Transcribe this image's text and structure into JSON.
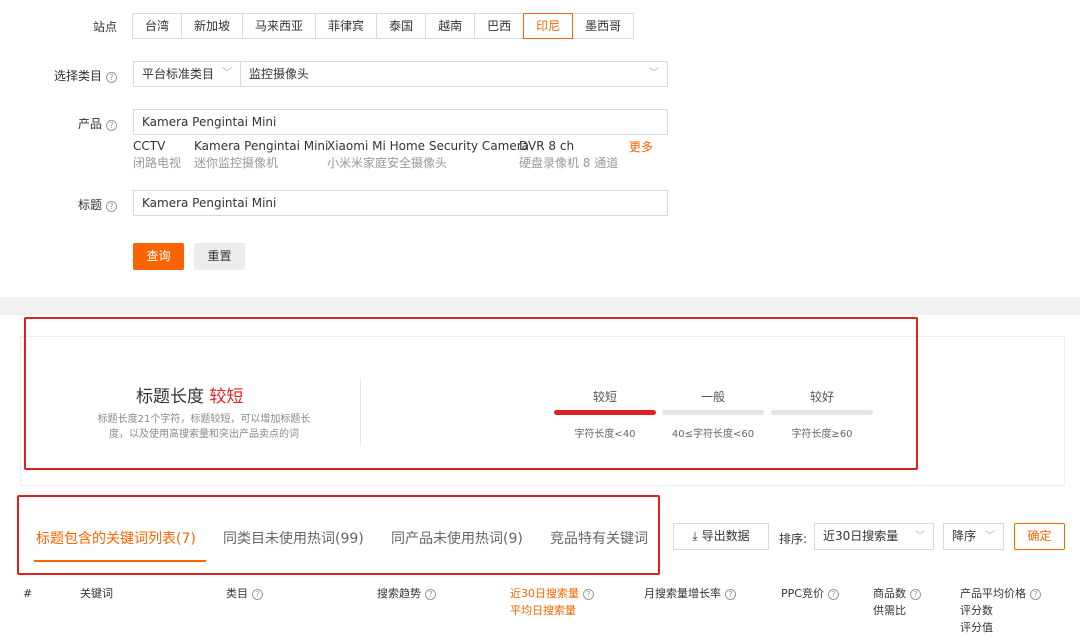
{
  "form": {
    "site_label": "站点",
    "sites": [
      "台湾",
      "新加坡",
      "马来西亚",
      "菲律宾",
      "泰国",
      "越南",
      "巴西",
      "印尼",
      "墨西哥"
    ],
    "active_site": "印尼",
    "category_label": "选择类目",
    "category_type": "平台标准类目",
    "category_value": "监控摄像头",
    "product_label": "产品",
    "product_value": "Kamera Pengintai Mini",
    "suggestions": [
      {
        "en": "CCTV",
        "cn": "闭路电视"
      },
      {
        "en": "Kamera Pengintai Mini",
        "cn": "迷你监控摄像机"
      },
      {
        "en": "Xiaomi Mi Home Security Camera",
        "cn": "小米米家庭安全摄像头"
      },
      {
        "en": "DVR 8 ch",
        "cn": "硬盘录像机 8 通道"
      }
    ],
    "more_label": "更多",
    "title_label": "标题",
    "title_value": "Kamera Pengintai Mini",
    "query_button": "查询",
    "reset_button": "重置"
  },
  "analysis": {
    "heading": "标题长度",
    "verdict": "较短",
    "description_line1": "标题长度21个字符，标题较短，可以增加标题长",
    "description_line2": "度，以及使用高搜索量和突出产品卖点的词",
    "levels": [
      {
        "label": "较短",
        "range": "字符长度<40",
        "active": true
      },
      {
        "label": "一般",
        "range": "40≤字符长度<60",
        "active": false
      },
      {
        "label": "较好",
        "range": "字符长度≥60",
        "active": false
      }
    ],
    "accent_color": "#e02020"
  },
  "tabs": {
    "items": [
      "标题包含的关键词列表(7)",
      "同类目未使用热词(99)",
      "同产品未使用热词(9)",
      "竞品特有关键词"
    ],
    "active_index": 0,
    "export_label": "导出数据",
    "sort_label": "排序:",
    "sort_value": "近30日搜索量",
    "order_value": "降序",
    "confirm_label": "确定"
  },
  "table": {
    "col_index": "#",
    "col_keyword": "关键词",
    "col_category": "类目",
    "col_trend": "搜索趋势",
    "col_search_30d": "近30日搜索量",
    "col_search_avg": "平均日搜索量",
    "col_growth": "月搜索量增长率",
    "col_ppc": "PPC竞价",
    "col_products": "商品数",
    "col_supply": "供需比",
    "col_price": "产品平均价格",
    "col_reviews": "评分数",
    "col_rating": "评分值"
  },
  "colors": {
    "brand_orange": "#fa6400",
    "highlight_red": "#e02020"
  }
}
